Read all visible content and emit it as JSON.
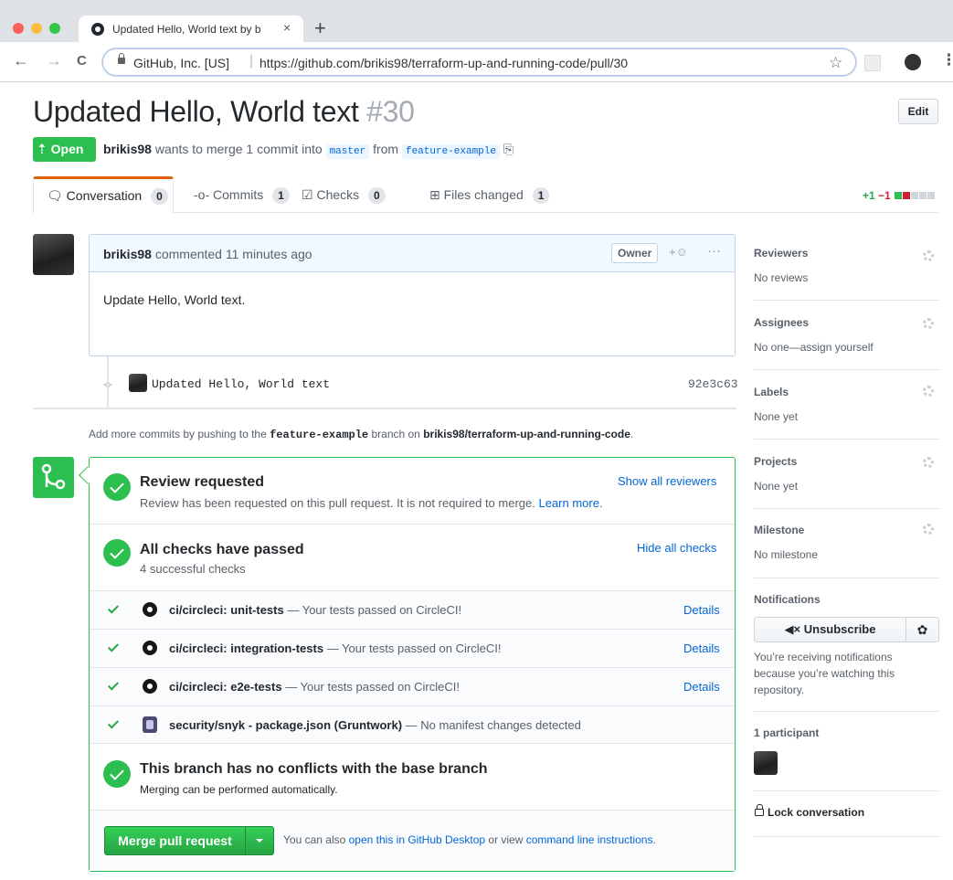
{
  "browser": {
    "tab_title": "Updated Hello, World text by b",
    "close_glyph": "×",
    "new_tab_glyph": "+",
    "back_glyph": "←",
    "forward_glyph": "→",
    "reload_glyph": "C",
    "org_label": "GitHub, Inc. [US]",
    "separator": "|",
    "url": "https://github.com/brikis98/terraform-up-and-running-code/pull/30",
    "star_glyph": "☆",
    "menu_glyph": "⋮",
    "traffic_colors": [
      "#fc605b",
      "#fdbc40",
      "#34c84a"
    ]
  },
  "pr": {
    "title": "Updated Hello, World text",
    "number": "#30",
    "edit_label": "Edit",
    "state_label": "Open",
    "state_icon": "pull-request-icon",
    "state_icon_glyph": "⇡",
    "author": "brikis98",
    "merge_desc": "wants to merge 1 commit into",
    "base_branch": "master",
    "from_word": "from",
    "head_branch": "feature-example",
    "copy_glyph": "⎘"
  },
  "tabs": [
    {
      "icon_glyph": "🗨",
      "label": "Conversation",
      "count": "0"
    },
    {
      "icon_glyph": "-o-",
      "label": "Commits",
      "count": "1"
    },
    {
      "icon_glyph": "☑",
      "label": "Checks",
      "count": "0"
    },
    {
      "icon_glyph": "⊞",
      "label": "Files changed",
      "count": "1"
    }
  ],
  "diffstat": {
    "additions": "+1",
    "deletions": "−1",
    "colors": [
      "#2cbe4e",
      "#cb2431",
      "#d1d5da"
    ]
  },
  "comment": {
    "author": "brikis98",
    "action": "commented",
    "time": "11 minutes ago",
    "owner_label": "Owner",
    "reaction_glyph": "+☺",
    "more_glyph": "···",
    "body": "Update Hello, World text."
  },
  "commit": {
    "message": "Updated Hello, World text",
    "sha": "92e3c63"
  },
  "push_hint": {
    "prefix": "Add more commits by pushing to the",
    "branch": "feature-example",
    "middle": "branch on",
    "repo": "brikis98/terraform-up-and-running-code",
    "suffix": "."
  },
  "merge": {
    "review_heading": "Review requested",
    "review_sub": "Review has been requested on this pull request. It is not required to merge.",
    "learn_more": "Learn more.",
    "show_reviewers": "Show all reviewers",
    "checks_heading": "All checks have passed",
    "checks_sub": "4 successful checks",
    "hide_checks": "Hide all checks",
    "checks": [
      {
        "name": "ci/circleci: unit-tests",
        "desc": "— Your tests passed on CircleCI!",
        "details": "Details",
        "icon": "circleci-icon"
      },
      {
        "name": "ci/circleci: integration-tests",
        "desc": "— Your tests passed on CircleCI!",
        "details": "Details",
        "icon": "circleci-icon"
      },
      {
        "name": "ci/circleci: e2e-tests",
        "desc": "— Your tests passed on CircleCI!",
        "details": "Details",
        "icon": "circleci-icon"
      },
      {
        "name": "security/snyk - package.json (Gruntwork)",
        "desc": "— No manifest changes detected",
        "details": "",
        "icon": "snyk-icon"
      }
    ],
    "conflict_heading": "This branch has no conflicts with the base branch",
    "conflict_sub": "Merging can be performed automatically.",
    "merge_button": "Merge pull request",
    "alt_prefix": "You can also",
    "alt_desktop": "open this in GitHub Desktop",
    "alt_middle": "or view",
    "alt_cli": "command line instructions",
    "alt_suffix": ".",
    "merge_icon_glyph": "⑂"
  },
  "sidebar": {
    "reviewers": {
      "heading": "Reviewers",
      "value": "No reviews"
    },
    "assignees": {
      "heading": "Assignees",
      "value": "No one—assign yourself"
    },
    "labels": {
      "heading": "Labels",
      "value": "None yet"
    },
    "projects": {
      "heading": "Projects",
      "value": "None yet"
    },
    "milestone": {
      "heading": "Milestone",
      "value": "No milestone"
    },
    "notifications": {
      "heading": "Notifications",
      "unsubscribe_glyph": "◀×",
      "unsubscribe": "Unsubscribe",
      "gear_glyph": "✿",
      "reason": "You’re receiving notifications because you’re watching this repository."
    },
    "participants": {
      "heading": "1 participant"
    },
    "lock_label": "Lock conversation"
  }
}
